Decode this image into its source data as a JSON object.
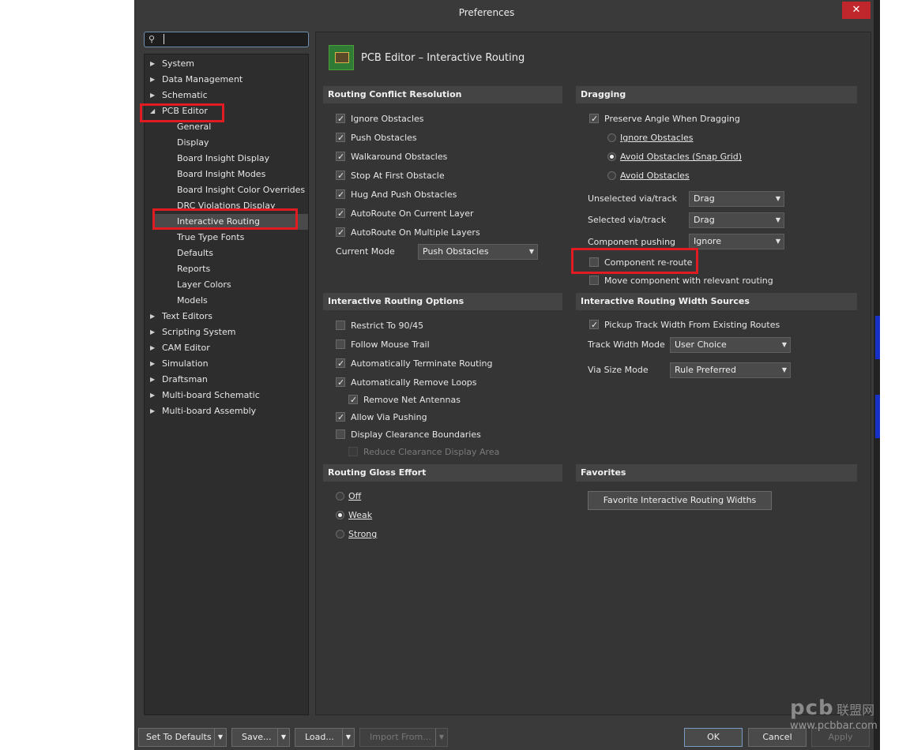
{
  "window": {
    "title": "Preferences",
    "close_glyph": "✕"
  },
  "search": {
    "value": ""
  },
  "tree": {
    "items": [
      {
        "label": "System",
        "state": "collapsed"
      },
      {
        "label": "Data Management",
        "state": "collapsed"
      },
      {
        "label": "Schematic",
        "state": "collapsed"
      },
      {
        "label": "PCB Editor",
        "state": "expanded"
      },
      {
        "label": "General"
      },
      {
        "label": "Display"
      },
      {
        "label": "Board Insight Display"
      },
      {
        "label": "Board Insight Modes"
      },
      {
        "label": "Board Insight Color Overrides"
      },
      {
        "label": "DRC Violations Display"
      },
      {
        "label": "Interactive Routing",
        "selected": true
      },
      {
        "label": "True Type Fonts"
      },
      {
        "label": "Defaults"
      },
      {
        "label": "Reports"
      },
      {
        "label": "Layer Colors"
      },
      {
        "label": "Models"
      },
      {
        "label": "Text Editors",
        "state": "collapsed"
      },
      {
        "label": "Scripting System",
        "state": "collapsed"
      },
      {
        "label": "CAM Editor",
        "state": "collapsed"
      },
      {
        "label": "Simulation",
        "state": "collapsed"
      },
      {
        "label": "Draftsman",
        "state": "collapsed"
      },
      {
        "label": "Multi-board Schematic",
        "state": "collapsed"
      },
      {
        "label": "Multi-board Assembly",
        "state": "collapsed"
      }
    ]
  },
  "page": {
    "title": "PCB Editor – Interactive Routing"
  },
  "conflict": {
    "header": "Routing Conflict Resolution",
    "options": [
      {
        "label": "Ignore Obstacles",
        "checked": true
      },
      {
        "label": "Push Obstacles",
        "checked": true
      },
      {
        "label": "Walkaround Obstacles",
        "checked": true
      },
      {
        "label": "Stop At First Obstacle",
        "checked": true
      },
      {
        "label": "Hug And Push Obstacles",
        "checked": true
      },
      {
        "label": "AutoRoute On Current Layer",
        "checked": true
      },
      {
        "label": "AutoRoute On Multiple Layers",
        "checked": true
      }
    ],
    "mode_label": "Current Mode",
    "mode_value": "Push Obstacles"
  },
  "dragging": {
    "header": "Dragging",
    "preserve_angle": {
      "label": "Preserve Angle When Dragging",
      "checked": true
    },
    "radios": [
      {
        "label": "Ignore Obstacles",
        "selected": false
      },
      {
        "label": "Avoid Obstacles (Snap Grid)",
        "selected": true
      },
      {
        "label": "Avoid Obstacles",
        "selected": false
      }
    ],
    "unselected_label": "Unselected via/track",
    "unselected_value": "Drag",
    "selected_label": "Selected via/track",
    "selected_value": "Drag",
    "pushing_label": "Component pushing",
    "pushing_value": "Ignore",
    "reroute": {
      "label": "Component re-route",
      "checked": false
    },
    "move_component": {
      "label": "Move component with relevant routing",
      "checked": false
    }
  },
  "options": {
    "header": "Interactive Routing Options",
    "items": [
      {
        "label": "Restrict To 90/45",
        "checked": false,
        "indent": false,
        "disabled": false
      },
      {
        "label": "Follow Mouse Trail",
        "checked": false,
        "indent": false,
        "disabled": false
      },
      {
        "label": "Automatically Terminate Routing",
        "checked": true,
        "indent": false,
        "disabled": false
      },
      {
        "label": "Automatically Remove Loops",
        "checked": true,
        "indent": false,
        "disabled": false
      },
      {
        "label": "Remove Net Antennas",
        "checked": true,
        "indent": true,
        "disabled": false
      },
      {
        "label": "Allow Via Pushing",
        "checked": true,
        "indent": false,
        "disabled": false
      },
      {
        "label": "Display Clearance Boundaries",
        "checked": false,
        "indent": false,
        "disabled": false
      },
      {
        "label": "Reduce Clearance Display Area",
        "checked": false,
        "indent": true,
        "disabled": true
      }
    ]
  },
  "width_sources": {
    "header": "Interactive Routing Width Sources",
    "pickup": {
      "label": "Pickup Track Width From Existing Routes",
      "checked": true
    },
    "track_label": "Track Width Mode",
    "track_value": "User Choice",
    "via_label": "Via Size Mode",
    "via_value": "Rule Preferred"
  },
  "gloss": {
    "header": "Routing Gloss Effort",
    "options": [
      {
        "label": "Off",
        "selected": false
      },
      {
        "label": "Weak",
        "selected": true
      },
      {
        "label": "Strong",
        "selected": false
      }
    ]
  },
  "favorites": {
    "header": "Favorites",
    "button": "Favorite Interactive Routing Widths"
  },
  "footer": {
    "set_defaults": "Set To Defaults",
    "save": "Save...",
    "load": "Load...",
    "import": "Import From...",
    "ok": "OK",
    "cancel": "Cancel",
    "apply": "Apply"
  },
  "watermark": {
    "brand": "pcb",
    "cn": "联盟网",
    "url": "www.pcbbar.com"
  },
  "colors": {
    "highlight": "#e01c22",
    "panel": "#353535",
    "window": "#3a3a3a",
    "section": "#444444"
  }
}
